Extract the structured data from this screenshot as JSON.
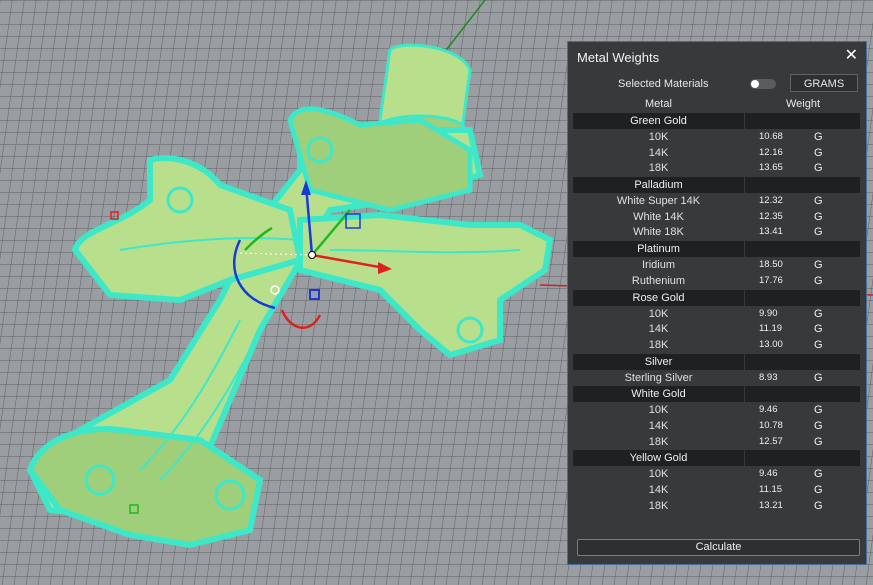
{
  "panel": {
    "title": "Metal Weights",
    "close_label": "✕",
    "selected_materials_label": "Selected Materials",
    "unit_button_label": "GRAMS",
    "col_metal": "Metal",
    "col_weight": "Weight",
    "calculate_label": "Calculate"
  },
  "groups": [
    {
      "name": "Green Gold",
      "rows": [
        {
          "name": "10K",
          "weight": "10.68",
          "unit": "G"
        },
        {
          "name": "14K",
          "weight": "12.16",
          "unit": "G"
        },
        {
          "name": "18K",
          "weight": "13.65",
          "unit": "G"
        }
      ]
    },
    {
      "name": "Palladium",
      "rows": [
        {
          "name": "White Super 14K",
          "weight": "12.32",
          "unit": "G"
        },
        {
          "name": "White 14K",
          "weight": "12.35",
          "unit": "G"
        },
        {
          "name": "White 18K",
          "weight": "13.41",
          "unit": "G"
        }
      ]
    },
    {
      "name": "Platinum",
      "rows": [
        {
          "name": "Iridium",
          "weight": "18.50",
          "unit": "G"
        },
        {
          "name": "Ruthenium",
          "weight": "17.76",
          "unit": "G"
        }
      ]
    },
    {
      "name": "Rose Gold",
      "rows": [
        {
          "name": "10K",
          "weight": "9.90",
          "unit": "G"
        },
        {
          "name": "14K",
          "weight": "11.19",
          "unit": "G"
        },
        {
          "name": "18K",
          "weight": "13.00",
          "unit": "G"
        }
      ]
    },
    {
      "name": "Silver",
      "rows": [
        {
          "name": "Sterling Silver",
          "weight": "8.93",
          "unit": "G"
        }
      ]
    },
    {
      "name": "White Gold",
      "rows": [
        {
          "name": "10K",
          "weight": "9.46",
          "unit": "G"
        },
        {
          "name": "14K",
          "weight": "10.78",
          "unit": "G"
        },
        {
          "name": "18K",
          "weight": "12.57",
          "unit": "G"
        }
      ]
    },
    {
      "name": "Yellow Gold",
      "rows": [
        {
          "name": "10K",
          "weight": "9.46",
          "unit": "G"
        },
        {
          "name": "14K",
          "weight": "11.15",
          "unit": "G"
        },
        {
          "name": "18K",
          "weight": "13.21",
          "unit": "G"
        }
      ]
    }
  ],
  "colors": {
    "grid_background": "#9a9ea2",
    "model_highlight": "#3de8c8",
    "model_body": "#b8e08c",
    "panel_background": "#38393b",
    "group_header": "#1f2022"
  }
}
